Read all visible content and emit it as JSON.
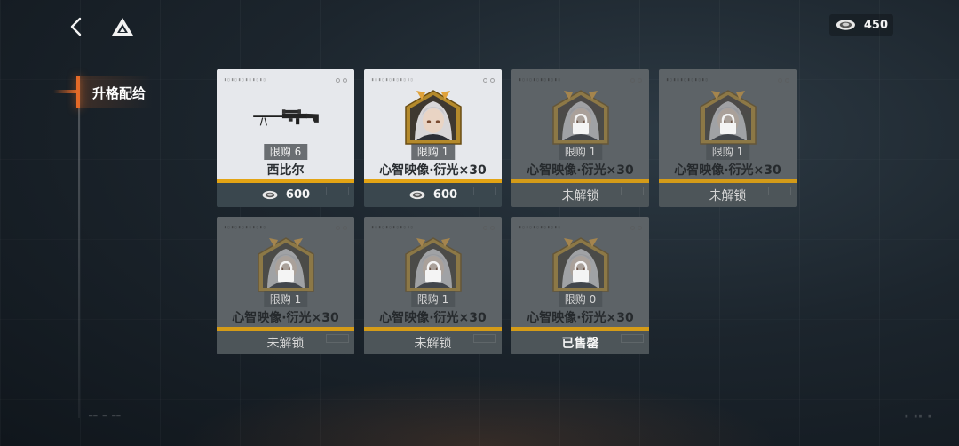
{
  "header": {
    "back_icon": "chevron-left-icon",
    "home_icon": "triangle-logo-icon",
    "currency": {
      "icon": "chip-coin-icon",
      "value": "450"
    }
  },
  "sidebar": {
    "tabs": [
      {
        "label": "升格配给",
        "active": true
      }
    ]
  },
  "shop": {
    "items": [
      {
        "art": "sniper-rifle",
        "limit_label": "限购 6",
        "name": "西比尔",
        "state": "available",
        "price": "600",
        "status": ""
      },
      {
        "art": "portrait",
        "limit_label": "限购 1",
        "name": "心智映像·衍光×30",
        "state": "available",
        "price": "600",
        "status": ""
      },
      {
        "art": "portrait",
        "limit_label": "限购 1",
        "name": "心智映像·衍光×30",
        "state": "locked",
        "price": "",
        "status": "未解锁"
      },
      {
        "art": "portrait",
        "limit_label": "限购 1",
        "name": "心智映像·衍光×30",
        "state": "locked",
        "price": "",
        "status": "未解锁"
      },
      {
        "art": "portrait",
        "limit_label": "限购 1",
        "name": "心智映像·衍光×30",
        "state": "locked",
        "price": "",
        "status": "未解锁"
      },
      {
        "art": "portrait",
        "limit_label": "限购 1",
        "name": "心智映像·衍光×30",
        "state": "locked",
        "price": "",
        "status": "未解锁"
      },
      {
        "art": "portrait",
        "limit_label": "限购 0",
        "name": "心智映像·衍光×30",
        "state": "soldout",
        "price": "",
        "status": "已售罄"
      }
    ]
  },
  "colors": {
    "accent_orange": "#e46a28",
    "divider_gold": "#e3a414",
    "footer_dark": "#3a474e"
  }
}
